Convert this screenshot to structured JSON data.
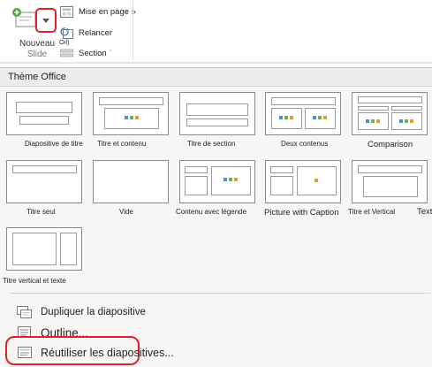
{
  "ribbon": {
    "new_slide_line1": "Nouveau",
    "new_slide_line2": "Slide",
    "layout_label": "Mise en page »",
    "reset_label": "Relancer",
    "oil_label": "Oil)",
    "section_label": "Section ˈ",
    "icons": [
      "new-slide-icon",
      "chevron-down-icon",
      "layout-icon",
      "reset-icon",
      "section-icon"
    ]
  },
  "gallery": {
    "header": "Thème Office",
    "layouts": [
      {
        "label": "Diapositive de titre"
      },
      {
        "label": "Titre et contenu"
      },
      {
        "label": "Titre de section"
      },
      {
        "label": "Deux contenus"
      },
      {
        "label": "Comparison"
      },
      {
        "label": "Titre seul"
      },
      {
        "label": "Vide"
      },
      {
        "label": "Contenu avec légende"
      },
      {
        "label": "Picture with Caption"
      },
      {
        "label": "Titre et Vertical"
      },
      {
        "label": "Text"
      },
      {
        "label": "Titre vertical et texte"
      }
    ]
  },
  "menu": {
    "duplicate": "Dupliquer la diapositive",
    "outline": "Outline...",
    "reuse": "Réutiliser les diapositives..."
  },
  "colors": {
    "highlight": "#e0202a",
    "icon_blue": "#4b8fd6",
    "icon_green": "#6cb24a",
    "icon_orange": "#e0a030",
    "panel_bg": "#f7f6f5"
  }
}
